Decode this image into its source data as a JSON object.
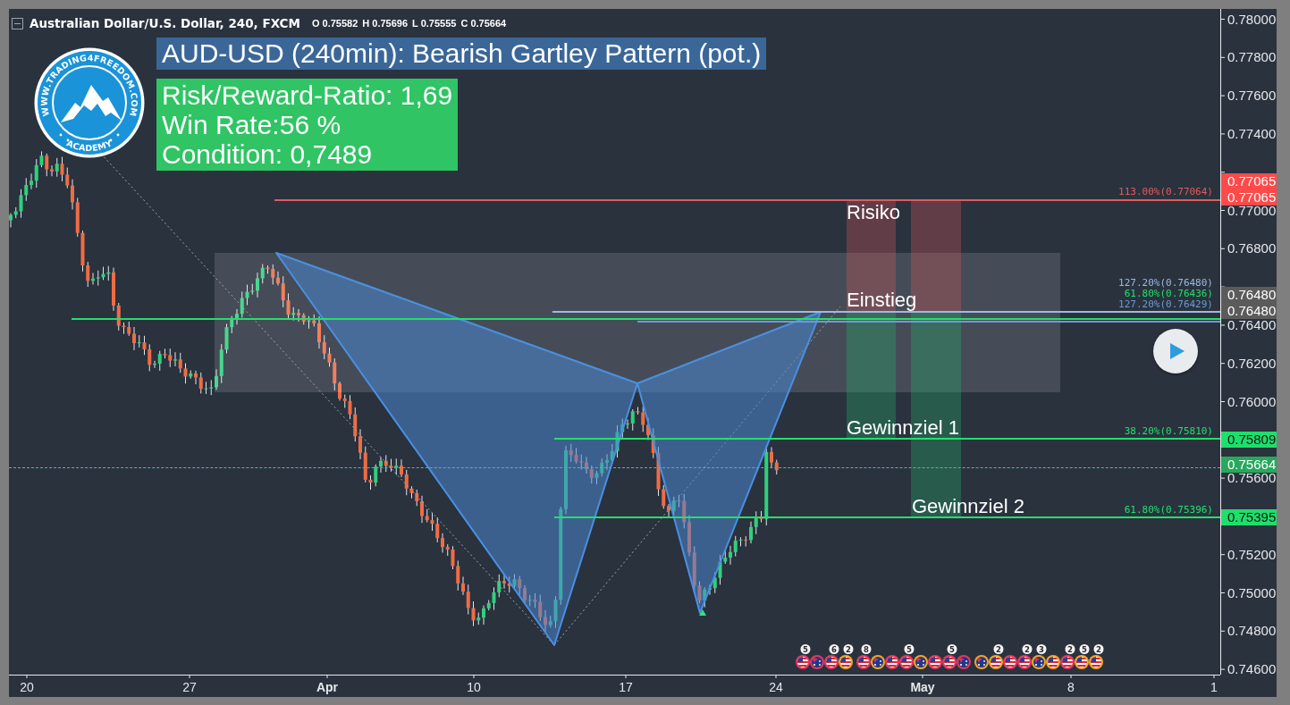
{
  "header": {
    "title": "Australian Dollar/U.S. Dollar, 240, FXCM",
    "ohlc": [
      {
        "label": "O",
        "value": "0.75582"
      },
      {
        "label": "H",
        "value": "0.75696"
      },
      {
        "label": "L",
        "value": "0.75555"
      },
      {
        "label": "C",
        "value": "0.75664"
      }
    ]
  },
  "banner": {
    "title": "AUD-USD (240min): Bearish Gartley Pattern (pot.)"
  },
  "stats": [
    "Risk/Reward-Ratio: 1,69",
    "Win Rate:56 %",
    "Condition: 0,7489"
  ],
  "logo": {
    "ring_text": "WWW.TRADING4FREEDOM.COM",
    "bottom_text": "ACADEMY"
  },
  "levels": [
    {
      "label": "113.00%(0.77064)",
      "color": "#e05c5c"
    },
    {
      "label": "127.20%(0.76480)",
      "color": "#9db9e2"
    },
    {
      "label": "61.80%(0.76436)",
      "color": "#22e06b"
    },
    {
      "label": "127.20%(0.76429)",
      "color": "#6c9bd6"
    },
    {
      "label": "38.20%(0.75810)",
      "color": "#22e06b"
    },
    {
      "label": "61.80%(0.75396)",
      "color": "#22e06b"
    }
  ],
  "position_labels": [
    "Risiko",
    "Einstieg",
    "Gewinnziel 1",
    "Gewinnziel 2"
  ],
  "price_axis": {
    "ticks": [
      "0.78000",
      "0.77800",
      "0.77600",
      "0.77400",
      "0.77000",
      "0.76800",
      "0.76400",
      "0.76200",
      "0.76000",
      "0.75600",
      "0.75200",
      "0.75000",
      "0.74800",
      "0.74600"
    ],
    "markers": [
      {
        "value": "0.77065",
        "color": "#ff4a4a"
      },
      {
        "value": "0.77065",
        "color": "#ff4a4a"
      },
      {
        "value": "0.76480",
        "color": "#5b5b5b"
      },
      {
        "value": "0.76480",
        "color": "#5b5b5b"
      },
      {
        "value": "0.75809",
        "color": "#1fde6c"
      },
      {
        "value": "0.75664",
        "color": "#27a85c"
      },
      {
        "value": "0.75395",
        "color": "#1fde6c"
      }
    ]
  },
  "time_axis": [
    {
      "text": "20",
      "kind": "day"
    },
    {
      "text": "27",
      "kind": "day"
    },
    {
      "text": "Apr",
      "kind": "month"
    },
    {
      "text": "10",
      "kind": "day"
    },
    {
      "text": "17",
      "kind": "day"
    },
    {
      "text": "24",
      "kind": "day"
    },
    {
      "text": "May",
      "kind": "month"
    },
    {
      "text": "8",
      "kind": "day"
    },
    {
      "text": "1",
      "kind": "day"
    }
  ],
  "event_groups": [
    {
      "markers": [
        {
          "kind": "us",
          "color": "#e8365d",
          "count": "5"
        },
        {
          "kind": "au",
          "color": "#e8365d"
        },
        {
          "kind": "us",
          "color": "#e8365d",
          "count": "6"
        },
        {
          "kind": "us",
          "color": "#f5a623",
          "count": "2"
        }
      ]
    },
    {
      "markers": [
        {
          "kind": "us",
          "color": "#e8365d",
          "count": "8"
        },
        {
          "kind": "au",
          "color": "#f5a623"
        },
        {
          "kind": "us",
          "color": "#e8365d"
        },
        {
          "kind": "us",
          "color": "#e8365d",
          "count": "5"
        },
        {
          "kind": "au",
          "color": "#f5a623"
        },
        {
          "kind": "us",
          "color": "#e8365d"
        },
        {
          "kind": "us",
          "color": "#e8365d",
          "count": "5"
        },
        {
          "kind": "au",
          "color": "#e8365d"
        }
      ]
    },
    {
      "markers": [
        {
          "kind": "au",
          "color": "#f5a623"
        },
        {
          "kind": "us",
          "color": "#f5a623",
          "count": "2"
        },
        {
          "kind": "us",
          "color": "#e8365d"
        },
        {
          "kind": "us",
          "color": "#e8365d",
          "count": "2"
        },
        {
          "kind": "au",
          "color": "#f5a623",
          "count": "3"
        },
        {
          "kind": "us",
          "color": "#f5a623"
        },
        {
          "kind": "us",
          "color": "#e8365d",
          "count": "2"
        },
        {
          "kind": "us",
          "color": "#f5a623",
          "count": "5"
        },
        {
          "kind": "us",
          "color": "#f5a623",
          "count": "2"
        }
      ]
    }
  ]
}
